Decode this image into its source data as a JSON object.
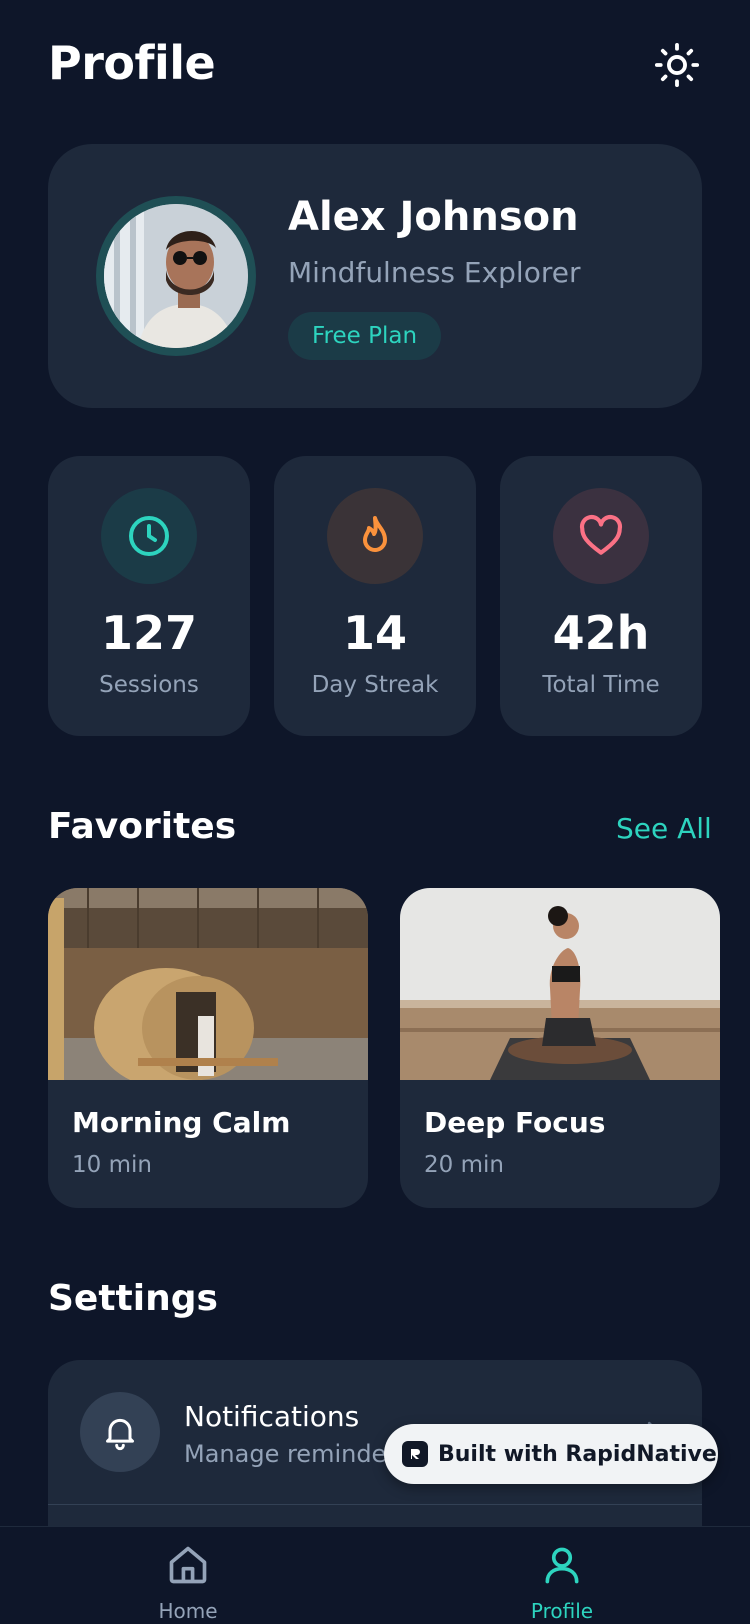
{
  "header": {
    "title": "Profile",
    "theme_icon": "sun-icon"
  },
  "profile": {
    "name": "Alex Johnson",
    "subtitle": "Mindfulness Explorer",
    "plan": "Free Plan"
  },
  "stats": [
    {
      "icon": "clock-icon",
      "value": "127",
      "label": "Sessions",
      "color": "#2dd4bf"
    },
    {
      "icon": "flame-icon",
      "value": "14",
      "label": "Day Streak",
      "color": "#fb923c"
    },
    {
      "icon": "heart-icon",
      "value": "42h",
      "label": "Total Time",
      "color": "#fb7185"
    }
  ],
  "favorites": {
    "title": "Favorites",
    "see_all": "See All",
    "items": [
      {
        "title": "Morning Calm",
        "duration": "10 min"
      },
      {
        "title": "Deep Focus",
        "duration": "20 min"
      }
    ]
  },
  "settings": {
    "title": "Settings",
    "items": [
      {
        "icon": "bell-icon",
        "title": "Notifications",
        "subtitle": "Manage reminders"
      }
    ]
  },
  "badge": {
    "text": "Built with RapidNative"
  },
  "tabbar": {
    "items": [
      {
        "icon": "home-icon",
        "label": "Home",
        "active": false
      },
      {
        "icon": "user-icon",
        "label": "Profile",
        "active": true
      }
    ]
  },
  "colors": {
    "background": "#0e1629",
    "card": "#1e293b",
    "accent": "#2dd4bf",
    "muted_text": "#94a3b8"
  }
}
